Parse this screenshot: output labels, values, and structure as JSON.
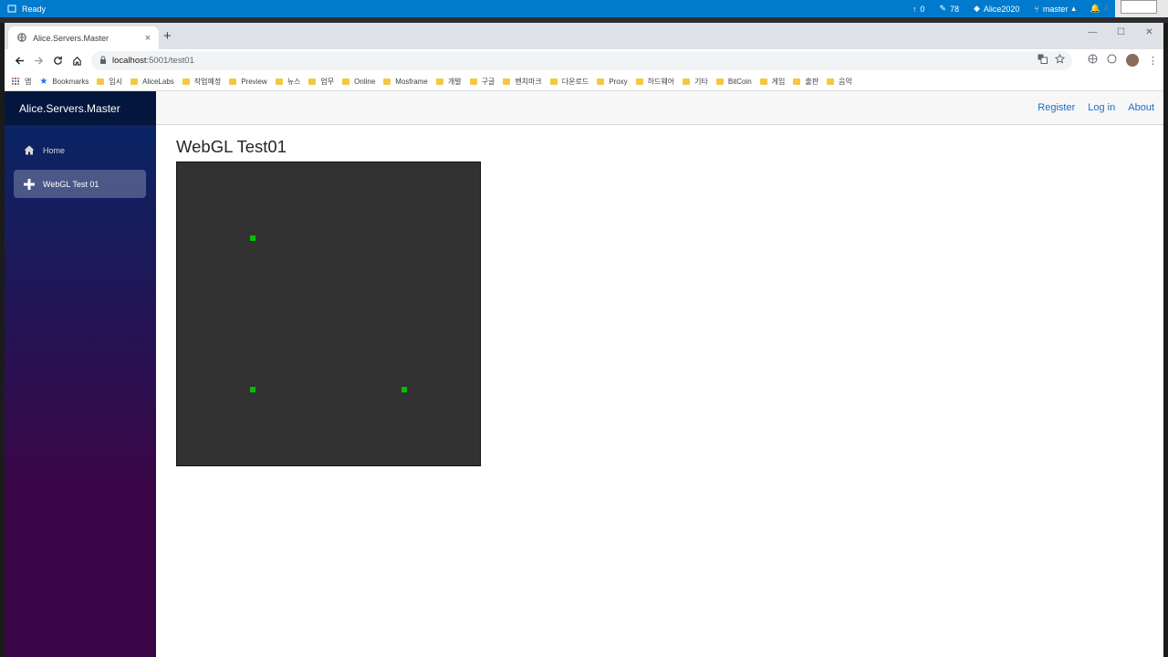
{
  "vs_status": {
    "ready": "Ready",
    "up_count": "0",
    "edit_count": "78",
    "repo": "Alice2020",
    "branch": "master",
    "notifications": "2"
  },
  "browser": {
    "tab_title": "Alice.Servers.Master",
    "tab_close": "×",
    "new_tab": "+",
    "url_host": "localhost",
    "url_path": ":5001/test01",
    "bookmarks": [
      {
        "label": "앱",
        "icon": "apps-icon"
      },
      {
        "label": "Bookmarks",
        "icon": "star-icon"
      },
      {
        "label": "임시",
        "icon": "folder-icon"
      },
      {
        "label": "AliceLabs",
        "icon": "folder-icon"
      },
      {
        "label": "작업예정",
        "icon": "folder-icon"
      },
      {
        "label": "Preview",
        "icon": "folder-icon"
      },
      {
        "label": "뉴스",
        "icon": "folder-icon"
      },
      {
        "label": "업무",
        "icon": "folder-icon"
      },
      {
        "label": "Online",
        "icon": "folder-icon"
      },
      {
        "label": "Mosframe",
        "icon": "folder-icon"
      },
      {
        "label": "개발",
        "icon": "folder-icon"
      },
      {
        "label": "구글",
        "icon": "folder-icon"
      },
      {
        "label": "벤치마크",
        "icon": "folder-icon"
      },
      {
        "label": "다운로드",
        "icon": "folder-icon"
      },
      {
        "label": "Proxy",
        "icon": "folder-icon"
      },
      {
        "label": "하드웨어",
        "icon": "folder-icon"
      },
      {
        "label": "기타",
        "icon": "folder-icon"
      },
      {
        "label": "BitCoin",
        "icon": "folder-icon"
      },
      {
        "label": "게임",
        "icon": "folder-icon"
      },
      {
        "label": "출판",
        "icon": "folder-icon"
      },
      {
        "label": "음악",
        "icon": "folder-icon"
      }
    ]
  },
  "app": {
    "brand": "Alice.Servers.Master",
    "nav": [
      {
        "label": "Home",
        "icon": "home-icon",
        "active": false
      },
      {
        "label": "WebGL Test 01",
        "icon": "plus-icon",
        "active": true
      }
    ],
    "top_links": [
      "Register",
      "Log in",
      "About"
    ],
    "page_title": "WebGL Test01",
    "canvas_bg": "#323232",
    "point_color": "#00c000",
    "points": [
      {
        "x": -0.5,
        "y": 0.5
      },
      {
        "x": -0.5,
        "y": -0.5
      },
      {
        "x": 0.5,
        "y": -0.5
      }
    ]
  }
}
